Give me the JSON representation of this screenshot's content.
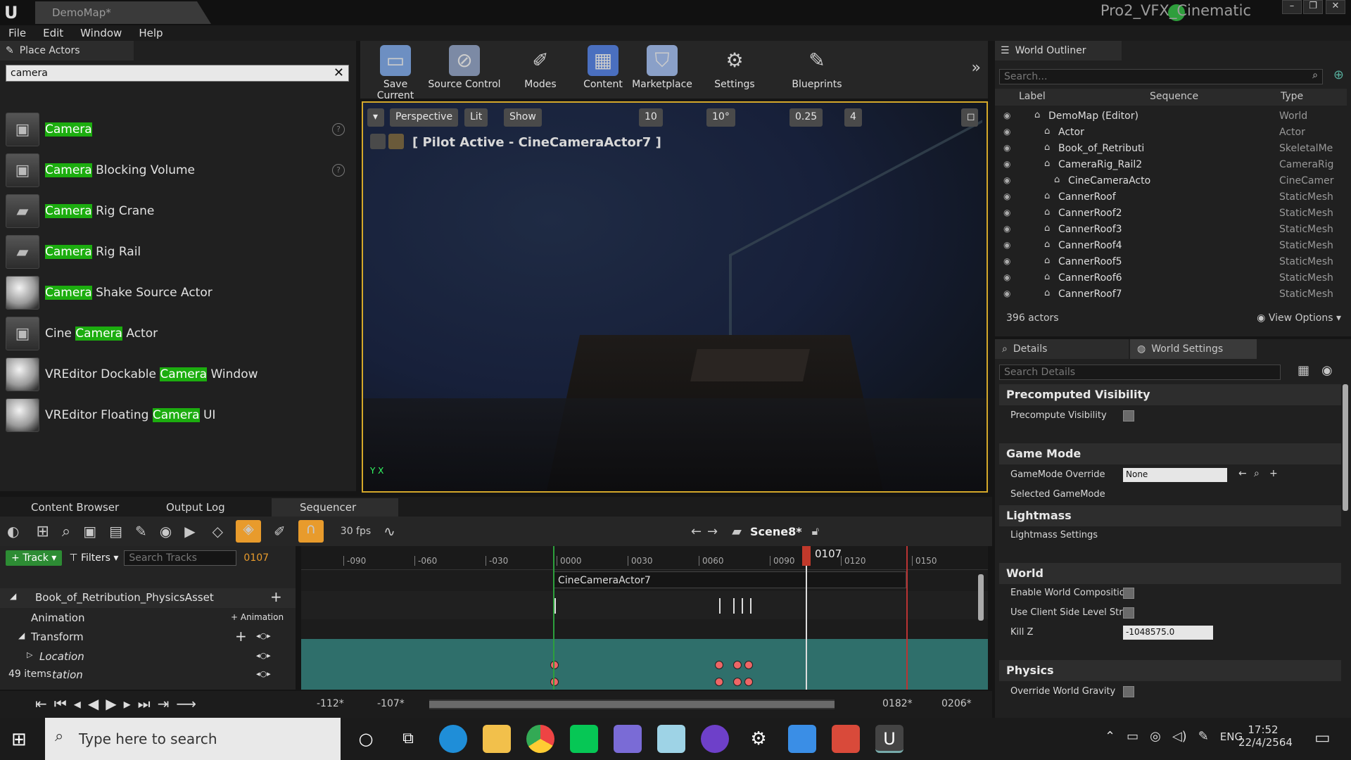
{
  "window": {
    "doc_tab": "DemoMap*",
    "project_name": "Pro2_VFX_Cinematic",
    "min": "–",
    "max": "❐",
    "close": "✕"
  },
  "menu": [
    "File",
    "Edit",
    "Window",
    "Help"
  ],
  "place_actors": {
    "tab_label": "Place Actors",
    "search_value": "camera",
    "items": [
      {
        "pre": "",
        "hit": "Camera",
        "post": "",
        "help": true
      },
      {
        "pre": "",
        "hit": "Camera",
        "post": " Blocking Volume",
        "help": true
      },
      {
        "pre": "",
        "hit": "Camera",
        "post": " Rig Crane",
        "help": false
      },
      {
        "pre": "",
        "hit": "Camera",
        "post": " Rig Rail",
        "help": false
      },
      {
        "pre": "",
        "hit": "Camera",
        "post": " Shake Source Actor",
        "help": false
      },
      {
        "pre": "Cine ",
        "hit": "Camera",
        "post": " Actor",
        "help": false
      },
      {
        "pre": "VREditor Dockable ",
        "hit": "Camera",
        "post": " Window",
        "help": false
      },
      {
        "pre": "VREditor Floating ",
        "hit": "Camera",
        "post": " UI",
        "help": false
      }
    ]
  },
  "toolbar": {
    "save_current": "Save Current",
    "source_control": "Source Control",
    "modes": "Modes",
    "content": "Content",
    "marketplace": "Marketplace",
    "settings": "Settings",
    "blueprints": "Blueprints"
  },
  "viewport": {
    "perspective": "Perspective",
    "lit": "Lit",
    "show": "Show",
    "grid_snap": "10",
    "rot_snap": "10°",
    "scale_snap": "0.25",
    "cam_speed": "4",
    "pilot_label": "[ Pilot Active - CineCameraActor7 ]"
  },
  "bottom_tabs": [
    "Content Browser",
    "Output Log",
    "Sequencer"
  ],
  "sequencer": {
    "fps": "30 fps",
    "scene": "Scene8*",
    "track_btn": "Track",
    "filters_btn": "Filters",
    "search_placeholder": "Search Tracks",
    "current_frame": "0107",
    "playhead_label": "0107",
    "ruler": [
      "-090",
      "-060",
      "-030",
      "0000",
      "0030",
      "0060",
      "0090",
      "0120",
      "0150"
    ],
    "camera_cut": "CineCameraActor7",
    "tracks": {
      "actor": "Book_of_Retribution_PhysicsAsset",
      "animation": "Animation",
      "animation_add": "Animation",
      "transform": "Transform",
      "location": "Location",
      "items_count": "49 items",
      "rotation_partial": "tation"
    },
    "range": {
      "view_start": "-112*",
      "play_start": "-107*",
      "play_end": "0182*",
      "view_end": "0206*"
    }
  },
  "outliner": {
    "tab_label": "World Outliner",
    "search_placeholder": "Search...",
    "col_label": "Label",
    "col_sequence": "Sequence",
    "col_type": "Type",
    "rows": [
      {
        "label": "DemoMap (Editor)",
        "type": "World",
        "indent": 0
      },
      {
        "label": "Actor",
        "type": "Actor",
        "indent": 1
      },
      {
        "label": "Book_of_Retributi",
        "type": "SkeletalMe",
        "indent": 1
      },
      {
        "label": "CameraRig_Rail2",
        "type": "CameraRig",
        "indent": 1
      },
      {
        "label": "CineCameraActo",
        "type": "CineCamer",
        "indent": 2
      },
      {
        "label": "CannerRoof",
        "type": "StaticMesh",
        "indent": 1
      },
      {
        "label": "CannerRoof2",
        "type": "StaticMesh",
        "indent": 1
      },
      {
        "label": "CannerRoof3",
        "type": "StaticMesh",
        "indent": 1
      },
      {
        "label": "CannerRoof4",
        "type": "StaticMesh",
        "indent": 1
      },
      {
        "label": "CannerRoof5",
        "type": "StaticMesh",
        "indent": 1
      },
      {
        "label": "CannerRoof6",
        "type": "StaticMesh",
        "indent": 1
      },
      {
        "label": "CannerRoof7",
        "type": "StaticMesh",
        "indent": 1
      }
    ],
    "actor_count": "396 actors",
    "view_options": "View Options"
  },
  "details": {
    "tab_details": "Details",
    "tab_world_settings": "World Settings",
    "search_placeholder": "Search Details",
    "sections": {
      "precomputed": "Precomputed Visibility",
      "precompute_visibility": "Precompute Visibility",
      "game_mode": "Game Mode",
      "gamemode_override": "GameMode Override",
      "gamemode_value": "None",
      "selected_gamemode": "Selected GameMode",
      "lightmass": "Lightmass",
      "lightmass_settings": "Lightmass Settings",
      "world": "World",
      "enable_world_composition": "Enable World Composition",
      "use_client_side": "Use Client Side Level Strea",
      "kill_z": "Kill Z",
      "kill_z_value": "-1048575.0",
      "physics": "Physics",
      "override_gravity": "Override World Gravity"
    }
  },
  "taskbar": {
    "search_placeholder": "Type here to search",
    "lang": "ENG",
    "time": "17:52",
    "date": "22/4/2564"
  },
  "colors": {
    "highlight": "#1cad0f",
    "viewport_border": "#d4a82a",
    "playhead": "#c0392b",
    "transform_track": "#2f6f6b"
  }
}
